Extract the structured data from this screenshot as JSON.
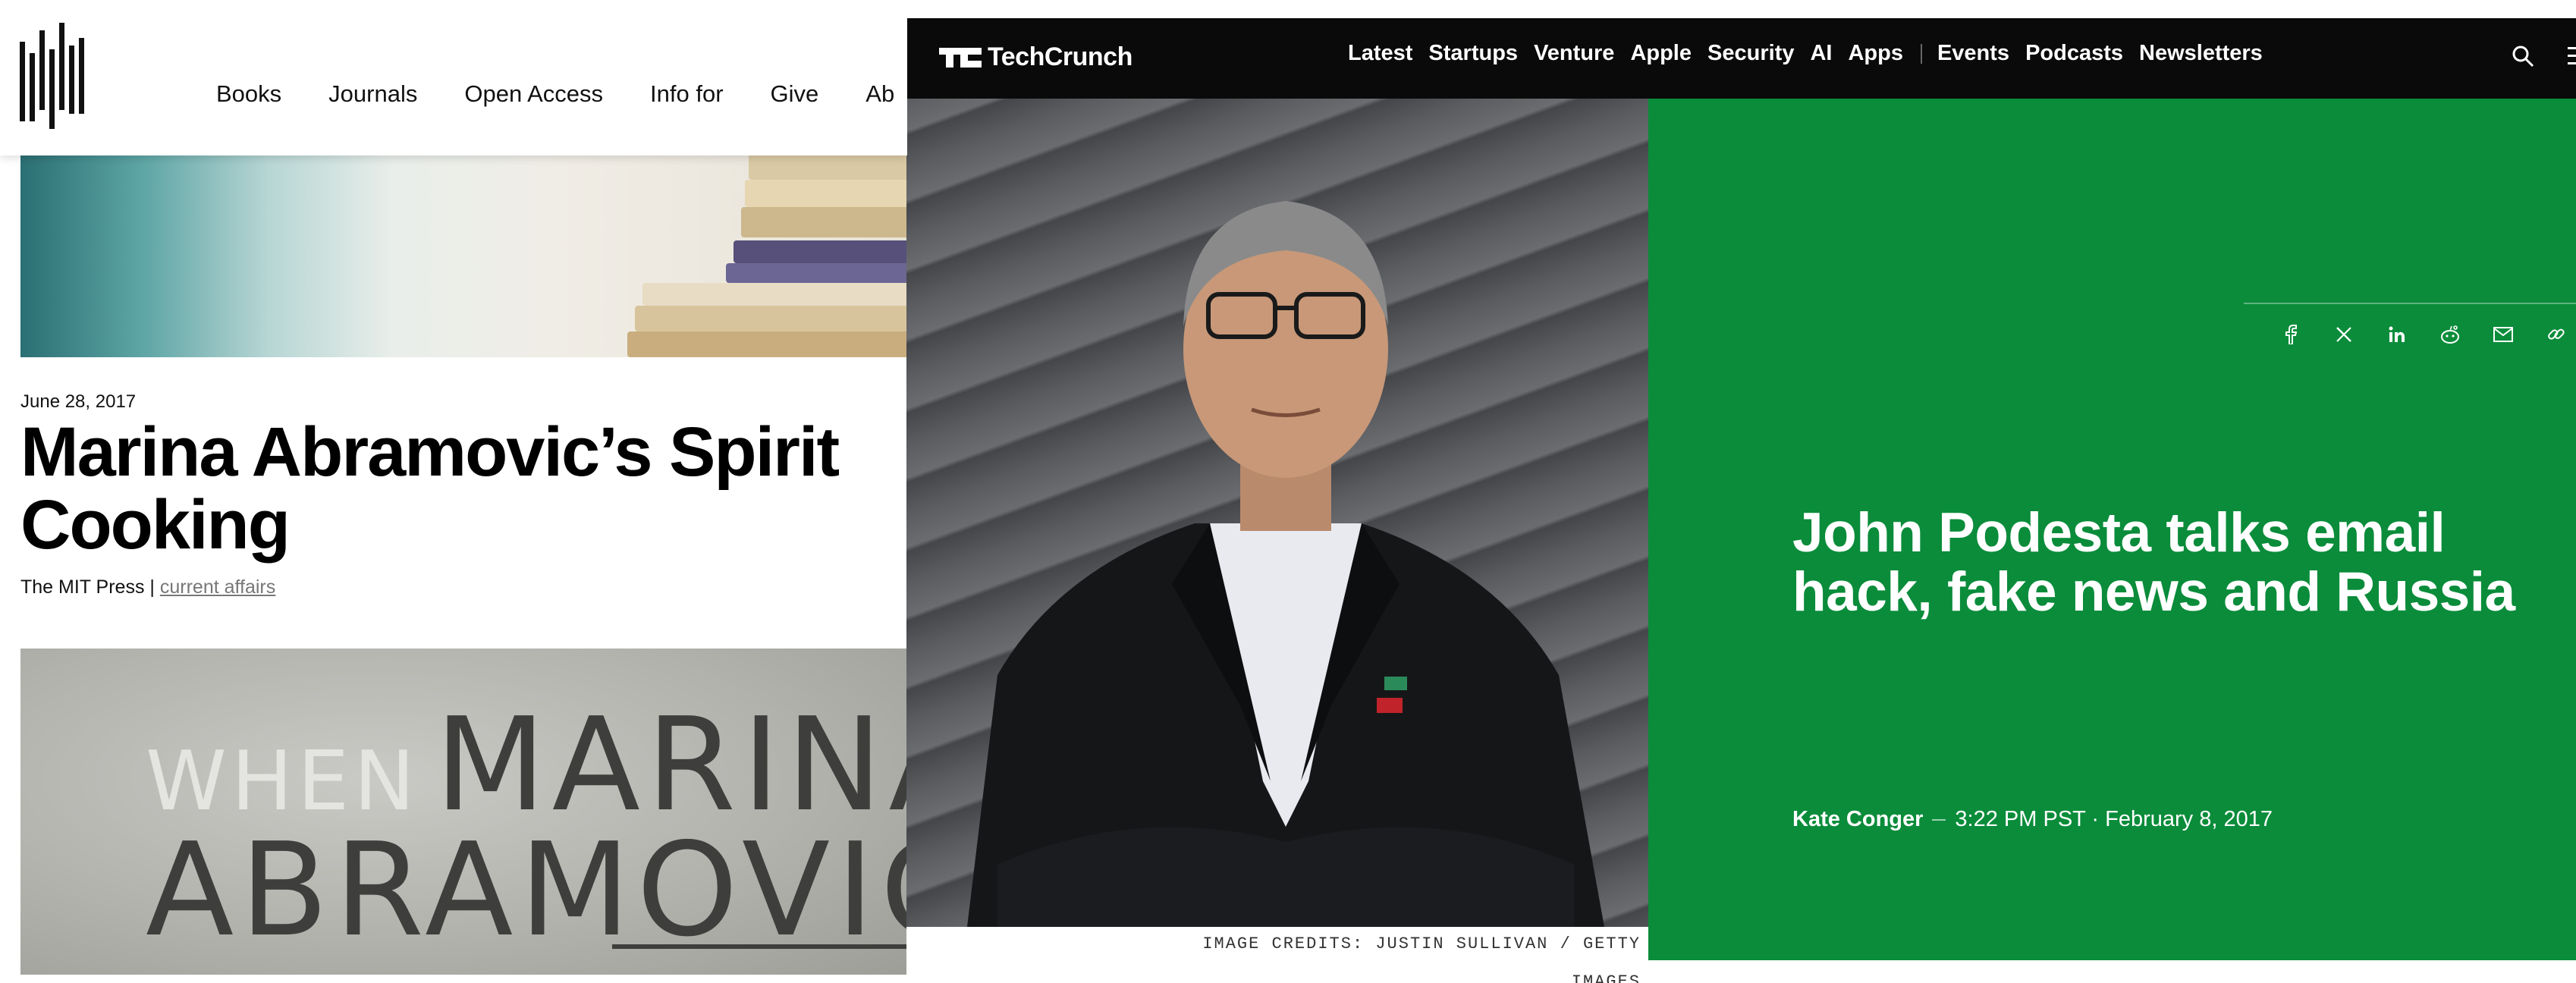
{
  "mit_press": {
    "logo": {
      "icon": "mit-press-logo-icon"
    },
    "nav": [
      "Books",
      "Journals",
      "Open Access",
      "Info for",
      "Give",
      "Ab"
    ],
    "article": {
      "date": "June 28, 2017",
      "title": "Marina Abramovic’s Spirit Cooking",
      "publisher": "The MIT Press |",
      "tag": "current affairs"
    },
    "book_cover": {
      "word1": "WHEN",
      "word2": "MARINA",
      "word3": "ABRAMOVIĆ"
    }
  },
  "techcrunch": {
    "logo": {
      "mark": "TC",
      "name": "TechCrunch"
    },
    "nav_primary": [
      "Latest",
      "Startups",
      "Venture",
      "Apple",
      "Security",
      "AI",
      "Apps"
    ],
    "nav_secondary": [
      "Events",
      "Podcasts",
      "Newsletters"
    ],
    "icons": {
      "search": "search-icon",
      "menu": "menu-icon"
    },
    "share_icons": [
      "facebook-icon",
      "x-icon",
      "linkedin-icon",
      "reddit-icon",
      "email-icon",
      "link-icon"
    ],
    "article": {
      "headline": "John Podesta talks email hack, fake news and Russia",
      "author": "Kate Conger",
      "timestamp": "3:22 PM PST · February 8, 2017",
      "image_credit": "IMAGE CREDITS: JUSTIN SULLIVAN / GETTY IMAGES"
    },
    "colors": {
      "bar": "#0a0a0a",
      "accent_green": "#0a8c3a"
    }
  }
}
